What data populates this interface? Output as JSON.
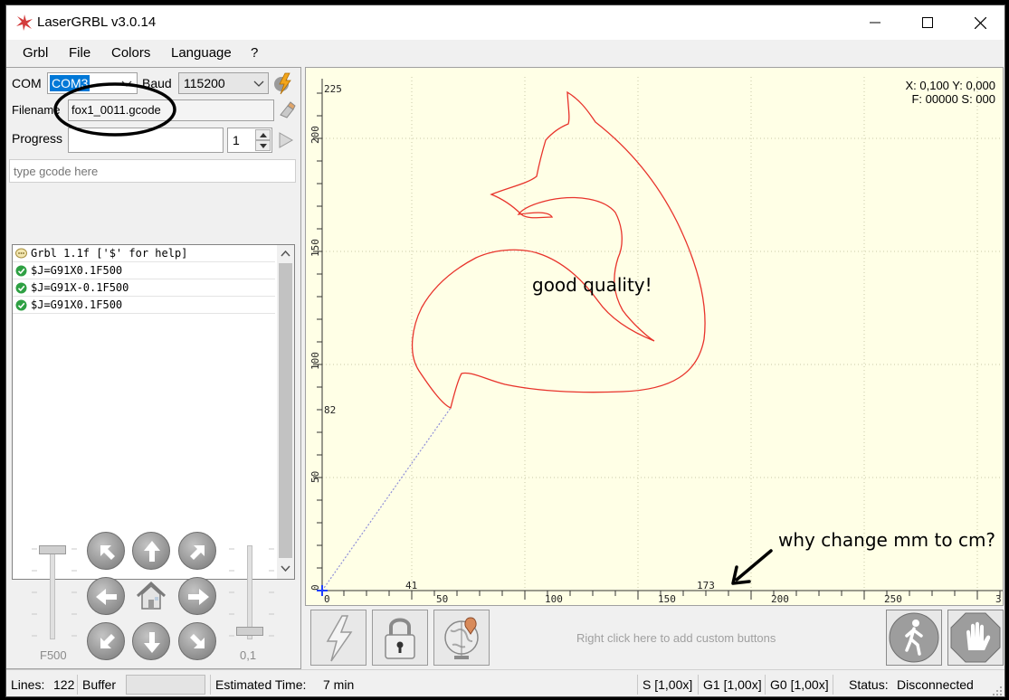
{
  "window": {
    "title": "LaserGRBL v3.0.14",
    "minimize": "–",
    "maximize": "☐",
    "close": "✕"
  },
  "menu": {
    "items": [
      "Grbl",
      "File",
      "Colors",
      "Language",
      "?"
    ]
  },
  "connection": {
    "com_label": "COM",
    "com_value": "COM3",
    "baud_label": "Baud",
    "baud_value": "115200"
  },
  "file": {
    "filename_label": "Filename",
    "filename_value": "fox1_0011.gcode"
  },
  "progress": {
    "label": "Progress",
    "value": 0,
    "copies": "1"
  },
  "gcode_input": {
    "placeholder": "type gcode here"
  },
  "console": {
    "lines": [
      {
        "text": "Grbl 1.1f ['$' for help]",
        "icon": "info-icon"
      },
      {
        "text": "$J=G91X0.1F500",
        "icon": "ok-icon"
      },
      {
        "text": "$J=G91X-0.1F500",
        "icon": "ok-icon"
      },
      {
        "text": "$J=G91X0.1F500",
        "icon": "ok-icon"
      }
    ]
  },
  "jog": {
    "speed_label": "F500",
    "step_label": "0,1",
    "speed_level": 0.95,
    "step_level": 0.05
  },
  "preview": {
    "position": "X: 0,100 Y: 0,000",
    "feed": "F: 00000 S: 000",
    "y_ticks": [
      "225",
      "200",
      "150",
      "100",
      "82",
      "50",
      "0"
    ],
    "x_ticks": [
      "0",
      "41",
      "50",
      "100",
      "150",
      "173",
      "200",
      "250",
      "3"
    ]
  },
  "custom_buttons": {
    "hint": "Right click here to add custom buttons"
  },
  "status": {
    "lines_label": "Lines:",
    "lines_value": "122",
    "buffer_label": "Buffer",
    "est_label": "Estimated Time:",
    "est_value": "7 min",
    "s_override": "S [1,00x]",
    "g1_override": "G1 [1,00x]",
    "g0_override": "G0 [1,00x]",
    "status_label": "Status:",
    "status_value": "Disconnected"
  },
  "annotations": {
    "quality": "good quality!",
    "question": "why change mm to cm?"
  },
  "colors": {
    "path": "#e8332b",
    "preview_bg": "#ffffe6",
    "selection": "#0078d7",
    "ok": "#2ea043"
  }
}
